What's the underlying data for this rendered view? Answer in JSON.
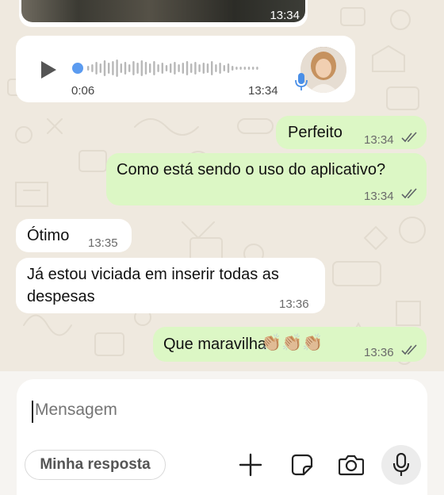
{
  "media_message": {
    "time": "13:34"
  },
  "voice_message": {
    "duration": "0:06",
    "time": "13:34",
    "icons": {
      "play": "play-icon",
      "mic": "microphone-icon",
      "avatar": "contact-avatar"
    }
  },
  "messages": [
    {
      "direction": "out",
      "text": "Perfeito",
      "time": "13:34",
      "status": "read"
    },
    {
      "direction": "out",
      "text": "Como está sendo o uso do aplicativo?",
      "time": "13:34",
      "status": "read"
    },
    {
      "direction": "in",
      "text": "Ótimo",
      "time": "13:35"
    },
    {
      "direction": "in",
      "text_line1": "Já estou viciada em inserir todas as",
      "text_line2": "despesas",
      "time": "13:36"
    },
    {
      "direction": "out",
      "text": "Que maravilha",
      "emoji": "👏🏼👏🏼👏🏼",
      "time": "13:36",
      "status": "read"
    }
  ],
  "composer": {
    "placeholder": "Mensagem",
    "quick_reply": "Minha resposta",
    "icons": [
      "plus-icon",
      "sticker-icon",
      "camera-icon",
      "microphone-icon"
    ]
  },
  "colors": {
    "outgoing_bubble": "#dcf7c5",
    "incoming_bubble": "#ffffff",
    "wallpaper": "#efe9df",
    "read_check": "#5f6368"
  }
}
